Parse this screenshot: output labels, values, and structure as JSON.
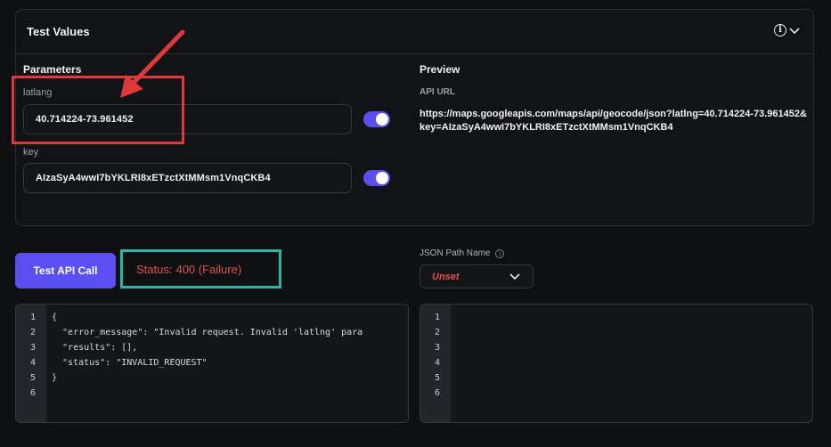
{
  "panel": {
    "title": "Test Values",
    "icons": [
      "info-icon",
      "chevron-down-icon"
    ]
  },
  "parameters": {
    "heading": "Parameters",
    "fields": [
      {
        "label": "latlang",
        "value": "40.714224-73.961452",
        "enabled": true
      },
      {
        "label": "key",
        "value": "AIzaSyA4wwI7bYKLRI8xETzctXtMMsm1VnqCKB4",
        "enabled": true
      }
    ]
  },
  "preview": {
    "heading": "Preview",
    "api_url_label": "API URL",
    "api_url": "https://maps.googleapis.com/maps/api/geocode/json?latlng=40.714224-73.961452&key=AIzaSyA4wwI7bYKLRI8xETzctXtMMsm1VnqCKB4"
  },
  "actions": {
    "test_button": "Test API Call",
    "status_label": "Status:",
    "status_value": "400 (Failure)"
  },
  "json_path": {
    "label": "JSON Path Name",
    "selected": "Unset"
  },
  "response_editor": {
    "line_numbers": [
      "1",
      "2",
      "3",
      "4",
      "5",
      "6"
    ],
    "lines": [
      "{",
      "  \"error_message\": \"Invalid request. Invalid 'latlng' para",
      "  \"results\": [],",
      "  \"status\": \"INVALID_REQUEST\"",
      "}",
      ""
    ]
  },
  "path_editor": {
    "line_numbers": [
      "1",
      "2",
      "3",
      "4",
      "5",
      "6"
    ],
    "lines": [
      "",
      "",
      "",
      "",
      "",
      ""
    ]
  },
  "colors": {
    "accent": "#5a4ff0",
    "error": "#e05252",
    "annotation_red": "#e0393b",
    "annotation_teal": "#2ab5a6"
  }
}
